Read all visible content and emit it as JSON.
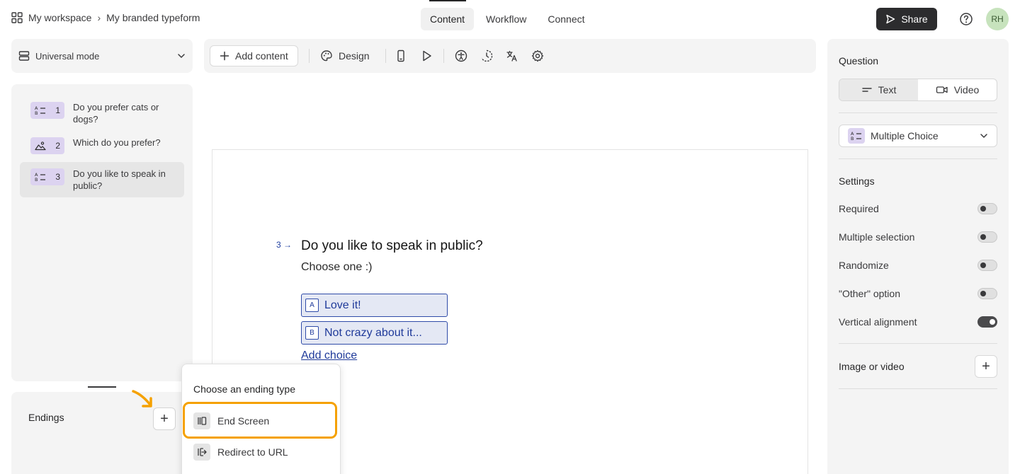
{
  "breadcrumb": {
    "workspace": "My workspace",
    "separator": "›",
    "form": "My branded typeform"
  },
  "top_tabs": [
    {
      "label": "Content",
      "active": true
    },
    {
      "label": "Workflow",
      "active": false
    },
    {
      "label": "Connect",
      "active": false
    }
  ],
  "header": {
    "share_label": "Share",
    "avatar_initials": "RH"
  },
  "mode": {
    "label": "Universal mode"
  },
  "questions": [
    {
      "number": "1",
      "text": "Do you prefer cats or dogs?",
      "icon": "multiple-choice-icon",
      "active": false
    },
    {
      "number": "2",
      "text": "Which do you prefer?",
      "icon": "picture-choice-icon",
      "active": false
    },
    {
      "number": "3",
      "text": "Do you like to speak in public?",
      "icon": "multiple-choice-icon",
      "active": true
    }
  ],
  "endings": {
    "label": "Endings"
  },
  "toolbar": {
    "add_content_label": "Add content",
    "design_label": "Design"
  },
  "canvas": {
    "question_number": "3",
    "question_title": "Do you like to speak in public?",
    "question_subtitle": "Choose one :)",
    "choices": [
      {
        "key": "A",
        "label": "Love it!"
      },
      {
        "key": "B",
        "label": "Not crazy about it..."
      }
    ],
    "add_choice_label": "Add choice"
  },
  "ending_popup": {
    "title": "Choose an ending type",
    "items": [
      {
        "label": "End Screen",
        "icon": "end-screen-icon",
        "highlighted": true
      },
      {
        "label": "Redirect to URL",
        "icon": "redirect-icon",
        "highlighted": false
      }
    ]
  },
  "right_panel": {
    "question_label": "Question",
    "segment": [
      {
        "label": "Text",
        "active": true
      },
      {
        "label": "Video",
        "active": false
      }
    ],
    "question_type": "Multiple Choice",
    "settings_label": "Settings",
    "settings": [
      {
        "label": "Required",
        "on": false
      },
      {
        "label": "Multiple selection",
        "on": false
      },
      {
        "label": "Randomize",
        "on": false
      },
      {
        "label": "\"Other\" option",
        "on": false
      },
      {
        "label": "Vertical alignment",
        "on": true
      }
    ],
    "image_or_video_label": "Image or video"
  },
  "colors": {
    "accent": "#1f3a9a",
    "highlight": "#f5a100",
    "share_bg": "#2c2c2e"
  }
}
